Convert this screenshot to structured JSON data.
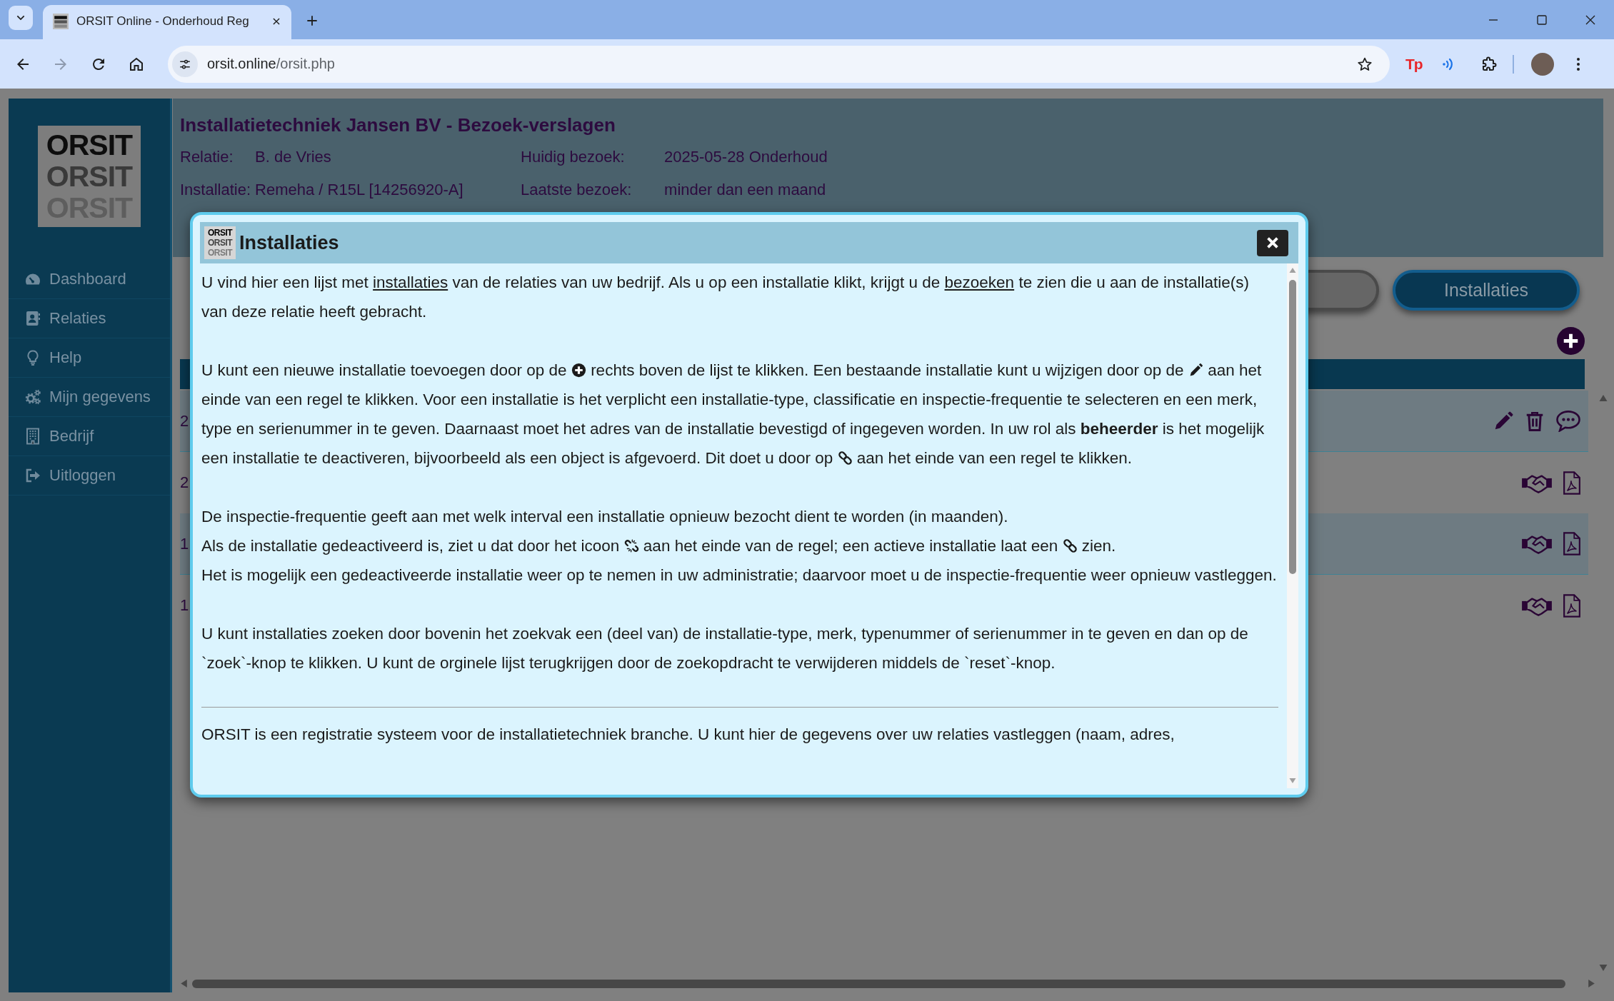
{
  "browser": {
    "tab": {
      "title": "ORSIT Online - Onderhoud Reg",
      "selected": true
    },
    "back": {
      "disabled": false
    },
    "forward": {
      "disabled": true
    },
    "address": {
      "host": "orsit.online",
      "path": "/orsit.php"
    },
    "extension_label": "Tp"
  },
  "sidebar": {
    "logo": [
      "ORSIT",
      "ORSIT",
      "ORSIT"
    ],
    "items": [
      {
        "label": "Dashboard"
      },
      {
        "label": "Relaties"
      },
      {
        "label": "Help"
      },
      {
        "label": "Mijn gegevens"
      },
      {
        "label": "Bedrijf"
      },
      {
        "label": "Uitloggen"
      }
    ]
  },
  "header": {
    "title": "Installatietechniek Jansen BV - Bezoek-verslagen",
    "fields": [
      {
        "label": "Relatie:",
        "value": "B. de Vries"
      },
      {
        "label": "Huidig bezoek:",
        "value": "2025-05-28 Onderhoud"
      },
      {
        "label": "Installatie:",
        "value": "Remeha / R15L [14256920-A]"
      },
      {
        "label": "Laatste bezoek:",
        "value": "minder dan een maand"
      }
    ]
  },
  "tabs": [
    {
      "selected": false
    },
    {
      "label": "Installaties",
      "selected": true
    }
  ],
  "table": {
    "rows": [
      {
        "kind": "installation",
        "column_1": "2"
      },
      {
        "kind": "visit",
        "column_1": "2"
      },
      {
        "kind": "visit",
        "column_1": "1"
      },
      {
        "kind": "visit",
        "column_1": "1"
      }
    ]
  },
  "modal": {
    "title": "Installaties",
    "logo": [
      "ORSIT",
      "ORSIT",
      "ORSIT"
    ],
    "blocks": [
      {
        "kind": "text",
        "lines": [
          [
            {
              "kind": "text",
              "text": "U vind hier een lijst met "
            },
            {
              "kind": "link",
              "text": "installaties"
            },
            {
              "kind": "text",
              "text": " van de relaties van uw bedrijf. Als u op een installatie klikt, krijgt u de "
            },
            {
              "kind": "link",
              "text": "bezoeken"
            },
            {
              "kind": "text",
              "text": " te zien die u aan de installatie(s) van deze relatie heeft gebracht."
            }
          ]
        ]
      },
      {
        "kind": "text",
        "lines": [
          [
            {
              "kind": "text",
              "text": "U kunt een nieuwe installatie toevoegen door op de "
            },
            {
              "kind": "plus"
            },
            {
              "kind": "text",
              "text": " rechts boven de lijst te klikken. Een bestaande installatie kunt u wijzigen door op de "
            },
            {
              "kind": "pencil"
            },
            {
              "kind": "text",
              "text": " aan het einde van een regel te klikken. Voor een installatie is het verplicht een installatie-type, classificatie en inspectie-frequentie te selecteren en een merk, type en serienummer in te geven. Daarnaast moet het adres van de installatie bevestigd of ingegeven worden. In uw rol als **beheerder** is het mogelijk een installatie te deactiveren, bijvoorbeeld als een object is afgevoerd. Dit doet u door op "
            },
            {
              "kind": "chain"
            },
            {
              "kind": "text",
              "text": " aan het einde van een regel te klikken."
            }
          ]
        ]
      },
      {
        "kind": "text",
        "lines": [
          [
            {
              "kind": "text",
              "text": "De inspectie-frequentie geeft aan met welk interval een installatie opnieuw bezocht dient te worden (in maanden)."
            }
          ],
          [
            {
              "kind": "text",
              "text": "Als de installatie gedeactiveerd is, ziet u dat door het icoon "
            },
            {
              "kind": "broken_chain"
            },
            {
              "kind": "text",
              "text": " aan het einde van de regel; een actieve installatie laat een "
            },
            {
              "kind": "chain"
            },
            {
              "kind": "text",
              "text": " zien."
            }
          ],
          [
            {
              "kind": "text",
              "text": "Het is mogelijk een gedeactiveerde installatie weer op te nemen in uw administratie; daarvoor moet u de inspectie-frequentie weer opnieuw vastleggen."
            }
          ]
        ]
      },
      {
        "kind": "text",
        "lines": [
          [
            {
              "kind": "text",
              "text": "U kunt installaties zoeken door bovenin het zoekvak een (deel van) de installatie-type, merk, typenummer of serienummer in te geven en dan op de `zoek`-knop te klikken. U kunt de orginele lijst terugkrijgen door de zoekopdracht te verwijderen middels de `reset`-knop."
            }
          ]
        ]
      },
      {
        "kind": "rule"
      },
      {
        "kind": "text",
        "lines": [
          [
            {
              "kind": "text",
              "text": "ORSIT is een registratie systeem voor de installatietechniek branche. U kunt hier de gegevens over uw relaties vastleggen (naam, adres,"
            }
          ]
        ]
      }
    ]
  }
}
